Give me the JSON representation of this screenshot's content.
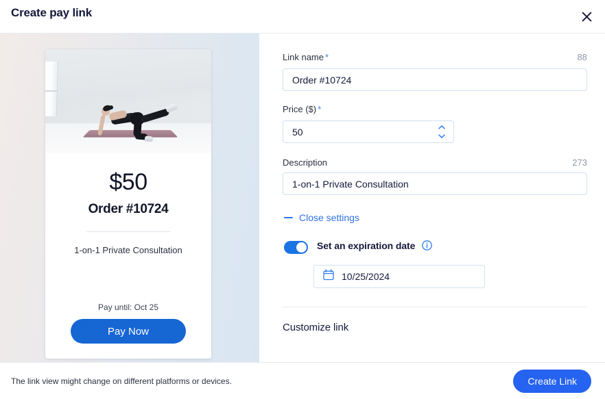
{
  "header": {
    "title": "Create pay link",
    "close_icon": "close-icon"
  },
  "preview": {
    "photo_alt": "woman-doing-pilates-pose-on-mat",
    "price": "$50",
    "link_name": "Order #10724",
    "description": "1-on-1 Private Consultation",
    "pay_until": "Pay until: Oct 25",
    "pay_button": "Pay Now"
  },
  "form": {
    "link_name": {
      "label": "Link name",
      "required_mark": "*",
      "counter": "88",
      "value": "Order #10724",
      "placeholder": "Link name"
    },
    "price": {
      "label": "Price ($)",
      "required_mark": "*",
      "value": "50",
      "placeholder": "0"
    },
    "description": {
      "label": "Description",
      "counter": "273",
      "value": "1-on-1 Private Consultation",
      "placeholder": "Description"
    },
    "close_settings": {
      "label": "Close settings",
      "icon": "minus-icon"
    },
    "expiration": {
      "toggle_state": "on",
      "label": "Set an expiration date",
      "info_icon": "info-icon",
      "date_value": "10/25/2024",
      "calendar_icon": "calendar-icon"
    },
    "customize_section_title": "Customize link"
  },
  "footer": {
    "note": "The link view might change on different platforms or devices.",
    "submit_label": "Create Link"
  },
  "colors": {
    "accent_blue": "#2563f0",
    "pay_blue": "#1666d4",
    "link_blue": "#2f72e8",
    "toggle_blue": "#1b74e4",
    "title_navy": "#15193b",
    "border_blue": "#d2e0f0"
  }
}
